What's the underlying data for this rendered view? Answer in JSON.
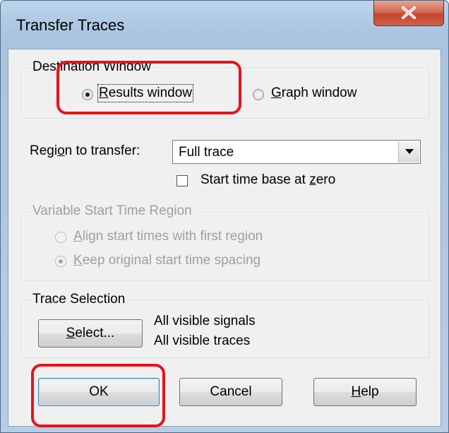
{
  "dialog": {
    "title": "Transfer Traces",
    "close_glyph": "✕"
  },
  "destination": {
    "legend": "Destination Window",
    "results": {
      "pre": "",
      "ul": "R",
      "post": "esults window",
      "selected": true
    },
    "graph": {
      "pre": "",
      "ul": "G",
      "post": "raph window",
      "selected": false
    }
  },
  "region": {
    "label_pre": "Regi",
    "label_ul": "o",
    "label_post": "n to transfer:",
    "value": "Full trace",
    "checkbox": {
      "pre": "Start time base at ",
      "ul": "z",
      "post": "ero",
      "checked": false
    }
  },
  "variable": {
    "legend": "Variable Start Time Region",
    "align": {
      "pre": "",
      "ul": "A",
      "post": "lign start times with first region",
      "selected": false,
      "disabled": true
    },
    "keep": {
      "pre": "",
      "ul": "K",
      "post": "eep original start time spacing",
      "selected": true,
      "disabled": true
    }
  },
  "trace_selection": {
    "legend": "Trace Selection",
    "select_button": {
      "ul": "S",
      "post": "elect..."
    },
    "signals_text": "All visible signals",
    "traces_text": "All visible traces"
  },
  "buttons": {
    "ok": "OK",
    "cancel": "Cancel",
    "help": {
      "ul": "H",
      "post": "elp"
    }
  },
  "colors": {
    "highlight": "#e8121a",
    "disabled_text": "#9f9f9f",
    "dialog_bg": "#f0f0f0"
  }
}
